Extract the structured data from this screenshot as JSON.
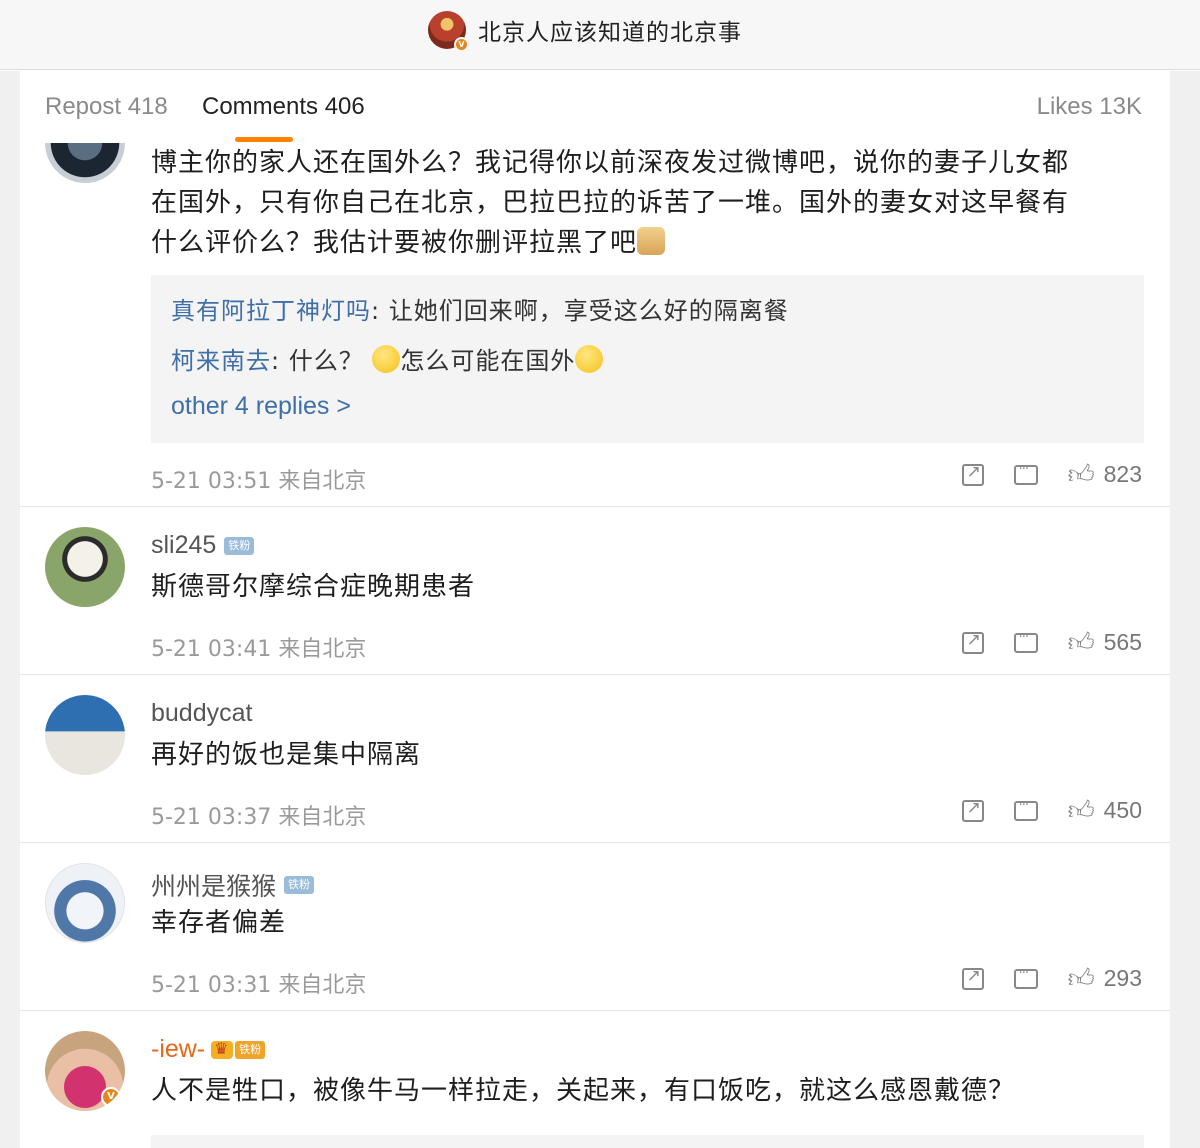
{
  "header": {
    "account_name": "北京人应该知道的北京事"
  },
  "tabs": {
    "repost": "Repost 418",
    "comments": "Comments 406",
    "likes": "Likes 13K"
  },
  "comments": [
    {
      "text_lines": [
        "博主你的家人还在国外么？我记得你以前深夜发过微博吧，说你的妻子儿女都",
        "在国外，只有你自己在北京，巴拉巴拉的诉苦了一堆。国外的妻女对这早餐有",
        "什么评价么？我估计要被你删评拉黑了吧"
      ],
      "replies": [
        {
          "user": "真有阿拉丁神灯吗",
          "sep": ": ",
          "text": "让她们回来啊，享受这么好的隔离餐"
        },
        {
          "user": "柯来南去",
          "sep": ": ",
          "text_a": "什么？",
          "text_b": "怎么可能在国外"
        }
      ],
      "more_replies": "other 4 replies >",
      "time": "5-21 03:51 来自北京",
      "likes": "823"
    },
    {
      "user": "sli245",
      "badge": "铁粉",
      "text": "斯德哥尔摩综合症晚期患者",
      "time": "5-21 03:41 来自北京",
      "likes": "565"
    },
    {
      "user": "buddycat",
      "text": "再好的饭也是集中隔离",
      "time": "5-21 03:37 来自北京",
      "likes": "450"
    },
    {
      "user": "州州是猴猴",
      "badge": "铁粉",
      "text": "幸存者偏差",
      "time": "5-21 03:31 来自北京",
      "likes": "293"
    },
    {
      "user": "-iew-",
      "badge": "铁粉",
      "text": "人不是牲口，被像牛马一样拉走，关起来，有口饭吃，就这么感恩戴德？"
    }
  ]
}
